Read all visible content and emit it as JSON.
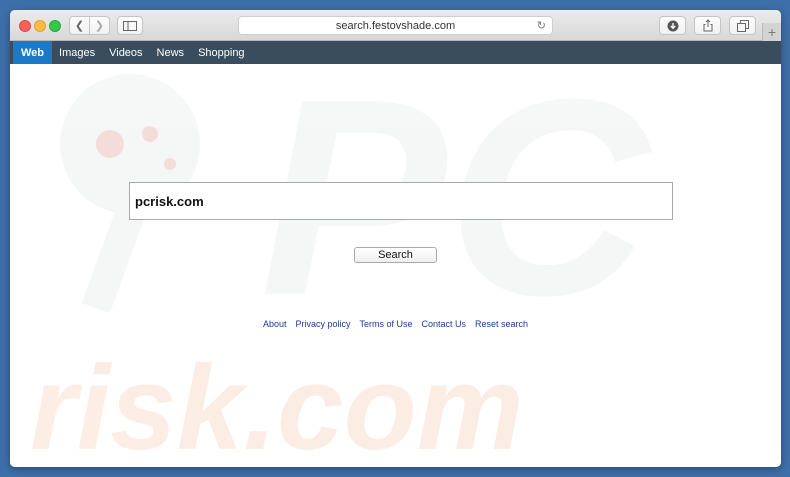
{
  "browser": {
    "url": "search.festovshade.com",
    "new_tab_label": "+"
  },
  "nav": {
    "items": [
      {
        "label": "Web"
      },
      {
        "label": "Images"
      },
      {
        "label": "Videos"
      },
      {
        "label": "News"
      },
      {
        "label": "Shopping"
      }
    ]
  },
  "search": {
    "value": "pcrisk.com",
    "button_label": "Search"
  },
  "footer": {
    "links": [
      {
        "label": "About"
      },
      {
        "label": "Privacy policy"
      },
      {
        "label": "Terms of Use"
      },
      {
        "label": "Contact Us"
      },
      {
        "label": "Reset search"
      }
    ]
  },
  "watermark": {
    "text": "risk.com",
    "logo_text": "PC"
  },
  "colors": {
    "nav_bg": "#3a4d5f",
    "nav_active": "#1a7ac8",
    "link": "#1a3b96",
    "desktop": "#3f6fa8"
  }
}
